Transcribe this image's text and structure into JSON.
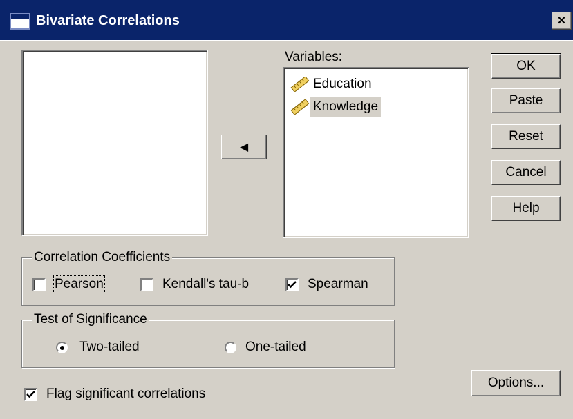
{
  "window": {
    "title": "Bivariate Correlations",
    "close_glyph": "×"
  },
  "variables_label": "Variables:",
  "variables": [
    {
      "label": "Education",
      "icon": "ruler-icon",
      "selected": false
    },
    {
      "label": "Knowledge",
      "icon": "ruler-icon",
      "selected": true
    }
  ],
  "move_button_glyph": "◀",
  "buttons": {
    "ok": "OK",
    "paste": "Paste",
    "reset": "Reset",
    "cancel": "Cancel",
    "help": "Help",
    "options": "Options..."
  },
  "correlation": {
    "legend": "Correlation Coefficients",
    "pearson": {
      "label": "Pearson",
      "checked": false
    },
    "kendall": {
      "label": "Kendall's tau-b",
      "checked": false
    },
    "spearman": {
      "label": "Spearman",
      "checked": true
    }
  },
  "significance": {
    "legend": "Test of Significance",
    "two_tailed": {
      "label": "Two-tailed",
      "selected": true
    },
    "one_tailed": {
      "label": "One-tailed",
      "selected": false
    }
  },
  "flag": {
    "label": "Flag significant correlations",
    "checked": true
  },
  "colors": {
    "titlebar": "#0a246a",
    "face": "#d4d0c8"
  }
}
